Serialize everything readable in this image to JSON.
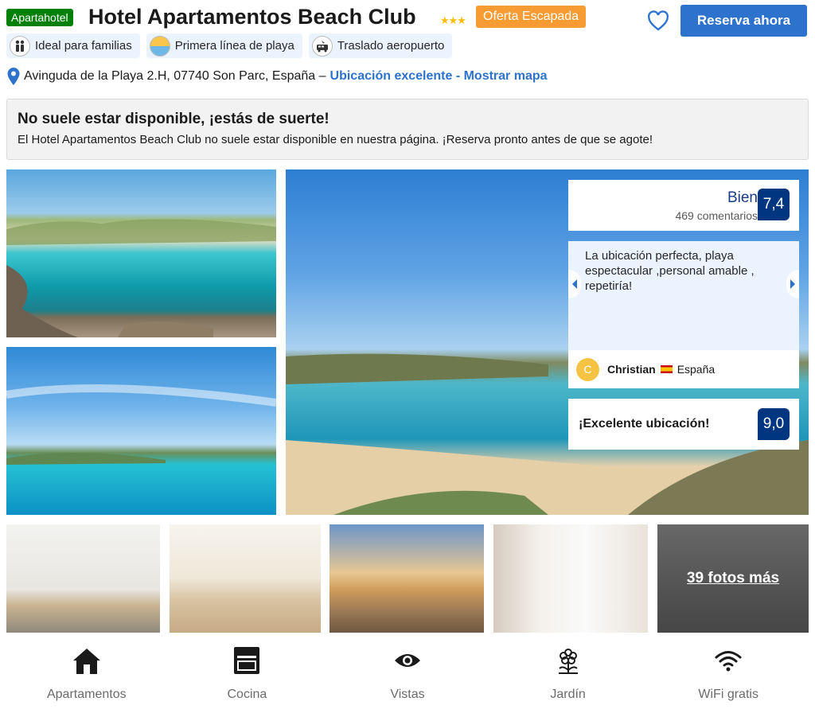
{
  "header": {
    "type_badge": "Apartahotel",
    "title": "Hotel Apartamentos Beach Club",
    "stars": "★★★",
    "offer_badge": "Oferta Escapada",
    "reserve_label": "Reserva ahora"
  },
  "chips": [
    {
      "label": "Ideal para familias",
      "icon": "family-icon"
    },
    {
      "label": "Primera línea de playa",
      "icon": "beach-sunset-icon"
    },
    {
      "label": "Traslado aeropuerto",
      "icon": "airport-shuttle-icon"
    }
  ],
  "address": {
    "text": "Avinguda de la Playa 2.H, 07740 Son Parc, España –",
    "link": "Ubicación excelente - Mostrar mapa"
  },
  "banner": {
    "title": "No suele estar disponible, ¡estás de suerte!",
    "text": "El Hotel Apartamentos Beach Club no suele estar disponible en nuestra página. ¡Reserva pronto antes de que se agote!"
  },
  "review": {
    "score_word": "Bien",
    "review_count": "469 comentarios",
    "score": "7,4",
    "quote": "La ubicación perfecta, playa espectacular ,personal amable , repetiría!",
    "reviewer_initial": "C",
    "reviewer_name": "Christian",
    "reviewer_country": "España",
    "location_label": "¡Excelente ubicación!",
    "location_score": "9,0"
  },
  "photos": {
    "more_label": "39 fotos más"
  },
  "amenities": [
    {
      "label": "Apartamentos",
      "icon": "house-icon"
    },
    {
      "label": "Cocina",
      "icon": "oven-icon"
    },
    {
      "label": "Vistas",
      "icon": "eye-icon"
    },
    {
      "label": "Jardín",
      "icon": "flower-icon"
    },
    {
      "label": "WiFi gratis",
      "icon": "wifi-icon"
    }
  ],
  "colors": {
    "primary_blue": "#2d72cc",
    "score_blue": "#003580",
    "green_badge": "#008009",
    "orange_badge": "#f79b33",
    "star_yellow": "#febb02"
  }
}
